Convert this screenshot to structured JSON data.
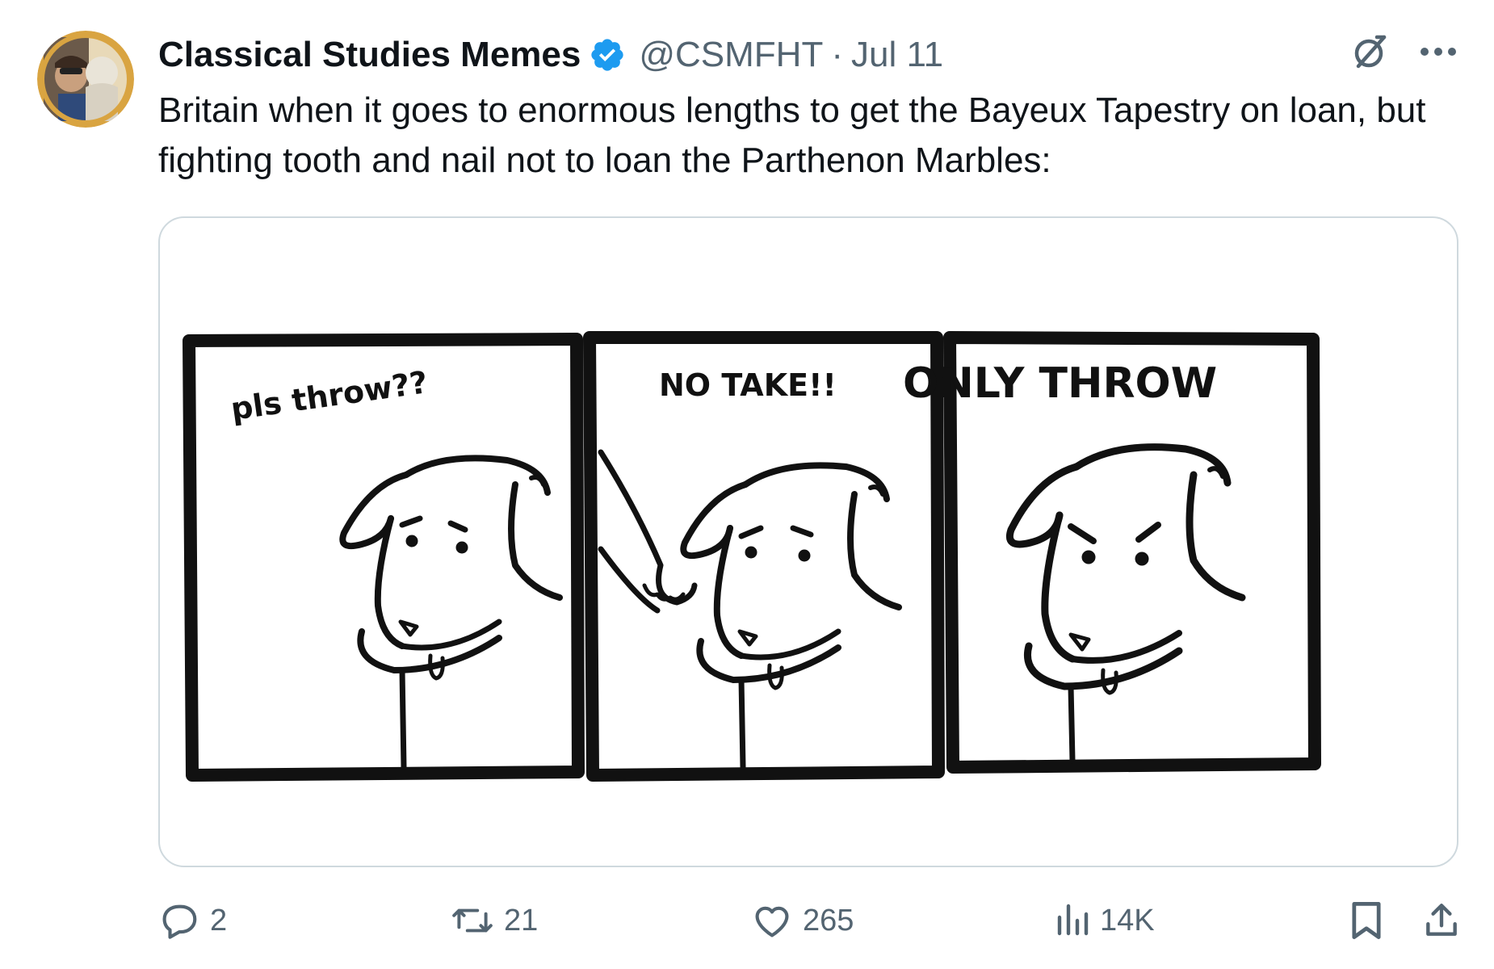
{
  "tweet": {
    "author": {
      "display_name": "Classical Studies Memes",
      "handle": "@CSMFHT",
      "verified_icon": "verified-badge-icon",
      "avatar_border_color": "#d9a441"
    },
    "separator": "·",
    "date": "Jul 11",
    "text": "Britain when it goes to enormous lengths to get the Bayeux Tapestry on loan, but fighting tooth and nail not to loan the Parthenon Marbles:",
    "media": {
      "panels": [
        {
          "caption": "pls throw??"
        },
        {
          "caption": "NO TAKE!!"
        },
        {
          "caption": "ONLY THROW"
        }
      ]
    },
    "actions": {
      "replies": "2",
      "reposts": "21",
      "likes": "265",
      "views": "14K"
    }
  },
  "colors": {
    "text_primary": "#0f1419",
    "text_secondary": "#536471",
    "verified_blue": "#1d9bf0",
    "border": "#cfd9de"
  }
}
